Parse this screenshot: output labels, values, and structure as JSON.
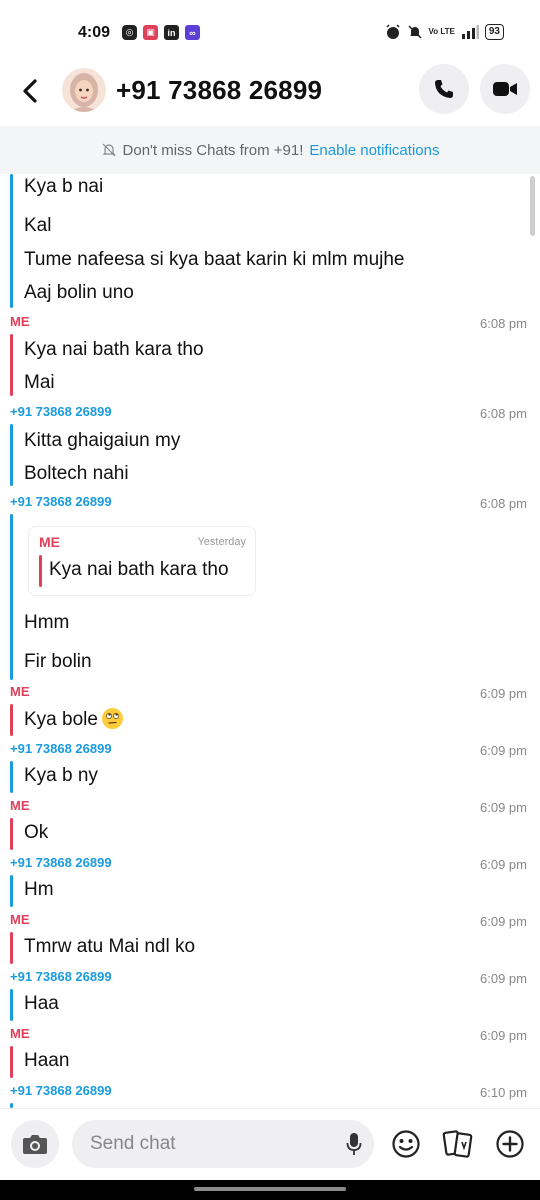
{
  "status_bar": {
    "time": "4:09",
    "battery": "93",
    "network": "Vo LTE"
  },
  "header": {
    "contact_name": "+91 73868 26899"
  },
  "notice": {
    "text": "Don't miss Chats from +91!",
    "link": "Enable notifications"
  },
  "chat": {
    "messages": [
      {
        "text": "Kya b nai"
      },
      {
        "text": "Kal"
      },
      {
        "text": "Tume nafeesa si kya baat karin ki mlm mujhe"
      },
      {
        "text": "Aaj bolin uno"
      },
      {
        "sender": "ME",
        "time": "6:08 pm"
      },
      {
        "text": "Kya nai bath kara tho"
      },
      {
        "text": "Mai"
      },
      {
        "sender": "+91 73868 26899",
        "time": "6:08 pm"
      },
      {
        "text": "Kitta ghaigaiun my"
      },
      {
        "text": "Boltech nahi"
      },
      {
        "sender": "+91 73868 26899",
        "time": "6:08 pm"
      },
      {
        "text": "Hmm"
      },
      {
        "text": "Fir bolin"
      },
      {
        "sender": "ME",
        "time": "6:09 pm"
      },
      {
        "text": "Kya bole"
      },
      {
        "sender": "+91 73868 26899",
        "time": "6:09 pm"
      },
      {
        "text": "Kya b ny"
      },
      {
        "sender": "ME",
        "time": "6:09 pm"
      },
      {
        "text": "Ok"
      },
      {
        "sender": "+91 73868 26899",
        "time": "6:09 pm"
      },
      {
        "text": "Hm"
      },
      {
        "sender": "ME",
        "time": "6:09 pm"
      },
      {
        "text": "Tmrw atu Mai ndl ko"
      },
      {
        "sender": "+91 73868 26899",
        "time": "6:09 pm"
      },
      {
        "text": "Haa"
      },
      {
        "sender": "ME",
        "time": "6:09 pm"
      },
      {
        "text": "Haan"
      },
      {
        "sender": "+91 73868 26899",
        "time": "6:10 pm"
      }
    ],
    "quote": {
      "sender": "ME",
      "time": "Yesterday",
      "text": "Kya nai bath kara tho"
    }
  },
  "composer": {
    "placeholder": "Send chat"
  },
  "colors": {
    "me": "#e0405a",
    "them": "#1a9bdf",
    "link": "#1a9bdf"
  },
  "icons": [
    "back-arrow-icon",
    "phone-icon",
    "video-camera-icon",
    "bell-off-icon",
    "camera-icon",
    "microphone-icon",
    "smiley-icon",
    "cards-icon",
    "plus-icon"
  ]
}
